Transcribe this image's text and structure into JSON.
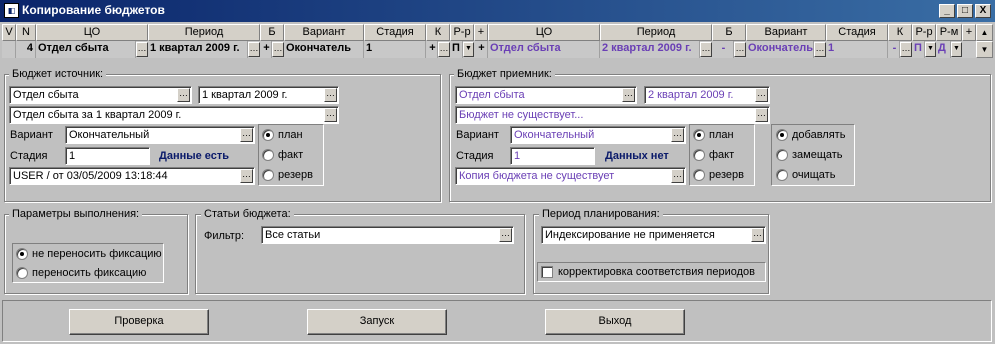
{
  "window": {
    "title": "Копирование бюджетов",
    "app_icon": "app-icon",
    "controls": [
      "_",
      "□",
      "X"
    ]
  },
  "grid": {
    "headers": [
      "V",
      "N",
      "ЦО",
      "Период",
      "Б",
      "Вариант",
      "Стадия",
      "К",
      "Р-р",
      "+",
      "ЦО",
      "Период",
      "Б",
      "Вариант",
      "Стадия",
      "К",
      "Р-р",
      "Р-м",
      "+"
    ],
    "row": {
      "n": "4",
      "src_co": "Отдел сбыта",
      "src_period": "1 квартал 2009 г.",
      "src_b": "+",
      "src_variant": "Окончатель",
      "src_stage": "1",
      "src_k": "+",
      "src_rr": "П",
      "plus": "+",
      "dst_co": "Отдел сбыта",
      "dst_period": "2 квартал 2009 г.",
      "dst_b": "-",
      "dst_variant": "Окончатель",
      "dst_stage": "1",
      "dst_k": "-",
      "dst_rr": "П",
      "dst_rm": "Д"
    }
  },
  "source": {
    "label": "Бюджет источник:",
    "co": "Отдел сбыта",
    "period": "1 квартал 2009 г.",
    "budget": "Отдел сбыта за 1 квартал 2009 г.",
    "variant_label": "Вариант",
    "variant": "Окончательный",
    "stage_label": "Стадия",
    "stage": "1",
    "status": "Данные есть",
    "user": "USER / от 03/05/2009 13:18:44",
    "radios": [
      "план",
      "факт",
      "резерв"
    ]
  },
  "target": {
    "label": "Бюджет приемник:",
    "co": "Отдел сбыта",
    "period": "2 квартал 2009 г.",
    "budget": "Бюджет не существует...",
    "variant_label": "Вариант",
    "variant": "Окончательный",
    "stage_label": "Стадия",
    "stage": "1",
    "status": "Данных нет",
    "copy": "Копия бюджета не существует",
    "radios": [
      "план",
      "факт",
      "резерв"
    ],
    "modes": [
      "добавлять",
      "замещать",
      "очищать"
    ]
  },
  "params": {
    "label": "Параметры выполнения:",
    "options": [
      "не переносить фиксацию",
      "переносить фиксацию"
    ]
  },
  "articles": {
    "label": "Статьи бюджета:",
    "filter_label": "Фильтр:",
    "filter": "Все статьи"
  },
  "planning": {
    "label": "Период планирования:",
    "value": "Индексирование не применяется",
    "checkbox": "корректировка соответствия периодов"
  },
  "buttons": {
    "check": "Проверка",
    "run": "Запуск",
    "exit": "Выход"
  },
  "colors": {
    "titlebar": "#0a246a",
    "face": "#c0c0c0",
    "purple_text": "#6a3fb5",
    "status_text": "#0a1a6a"
  }
}
